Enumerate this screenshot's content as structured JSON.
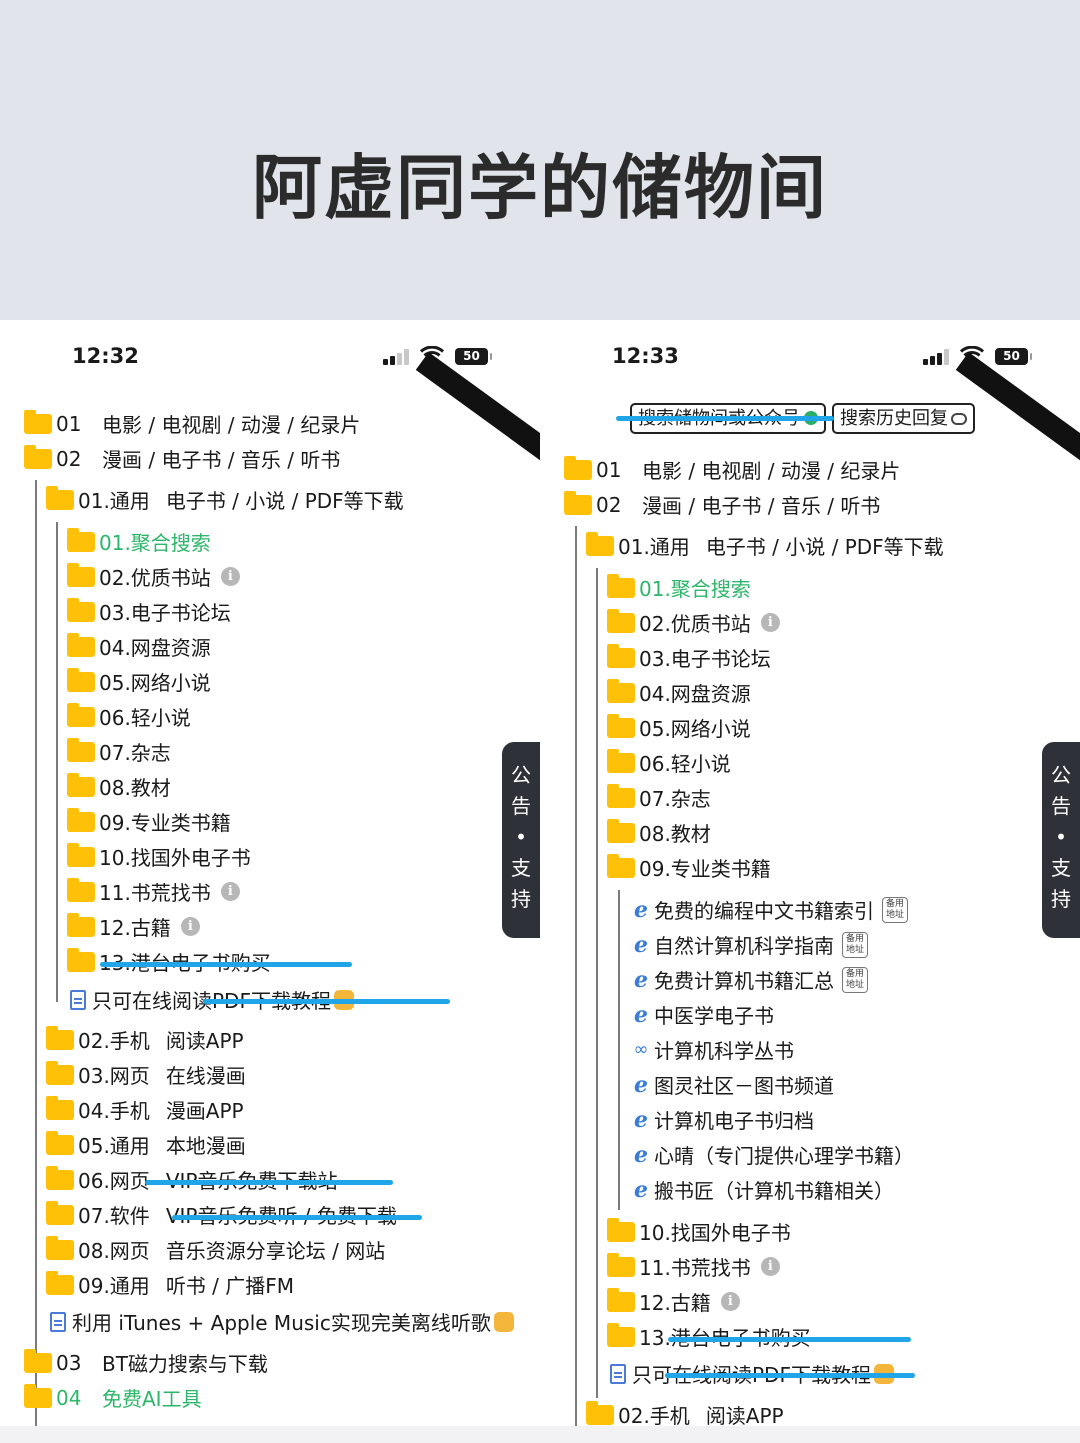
{
  "banner": {
    "title": "阿虚同学的储物间"
  },
  "left": {
    "time": "12:32",
    "battery": "50",
    "notice": [
      "公",
      "告",
      "•",
      "支",
      "持"
    ],
    "top_folders": [
      {
        "num": "01",
        "label": "电影 / 电视剧 / 动漫 / 纪录片"
      },
      {
        "num": "02",
        "label": "漫画 / 电子书 / 音乐 / 听书"
      }
    ],
    "sub_folder": {
      "num": "01.通用",
      "label": "电子书 / 小说 / PDF等下载"
    },
    "items": [
      {
        "label": "01.聚合搜索"
      },
      {
        "label": "02.优质书站"
      },
      {
        "label": "03.电子书论坛"
      },
      {
        "label": "04.网盘资源"
      },
      {
        "label": "05.网络小说"
      },
      {
        "label": "06.轻小说"
      },
      {
        "label": "07.杂志"
      },
      {
        "label": "08.教材"
      },
      {
        "label": "09.专业类书籍"
      },
      {
        "label": "10.找国外电子书"
      },
      {
        "label": "11.书荒找书"
      },
      {
        "label": "12.古籍"
      },
      {
        "label": "13.港台电子书购买"
      }
    ],
    "doc_item": "只可在线阅读PDF下载教程",
    "more_folders": [
      {
        "num": "02.手机",
        "label": "阅读APP"
      },
      {
        "num": "03.网页",
        "label": "在线漫画"
      },
      {
        "num": "04.手机",
        "label": "漫画APP"
      },
      {
        "num": "05.通用",
        "label": "本地漫画"
      },
      {
        "num": "06.网页",
        "label": "VIP音乐免费下载站"
      },
      {
        "num": "07.软件",
        "label": "VIP音乐免费听 / 免费下载"
      },
      {
        "num": "08.网页",
        "label": "音乐资源分享论坛 / 网站"
      },
      {
        "num": "09.通用",
        "label": "听书 / 广播FM"
      }
    ],
    "doc_item2": "利用 iTunes + Apple Music实现完美离线听歌",
    "bottom_folders": [
      {
        "num": "03",
        "label": "BT磁力搜索与下载"
      },
      {
        "num": "04",
        "label": "免费AI工具"
      }
    ]
  },
  "right": {
    "time": "12:33",
    "battery": "50",
    "notice": [
      "公",
      "告",
      "•",
      "支",
      "持"
    ],
    "search_chip": "搜索储物间或公众号",
    "history_chip": "搜索历史回复",
    "top_folders": [
      {
        "num": "01",
        "label": "电影 / 电视剧 / 动漫 / 纪录片"
      },
      {
        "num": "02",
        "label": "漫画 / 电子书 / 音乐 / 听书"
      }
    ],
    "sub_folder": {
      "num": "01.通用",
      "label": "电子书 / 小说 / PDF等下载"
    },
    "items": [
      {
        "label": "01.聚合搜索"
      },
      {
        "label": "02.优质书站"
      },
      {
        "label": "03.电子书论坛"
      },
      {
        "label": "04.网盘资源"
      },
      {
        "label": "05.网络小说"
      },
      {
        "label": "06.轻小说"
      },
      {
        "label": "07.杂志"
      },
      {
        "label": "08.教材"
      },
      {
        "label": "09.专业类书籍"
      }
    ],
    "links": [
      {
        "icon": "e",
        "label": "免费的编程中文书籍索引",
        "badge": "备用 地址"
      },
      {
        "icon": "e",
        "label": "自然计算机科学指南",
        "badge": "备用 地址"
      },
      {
        "icon": "e",
        "label": "免费计算机书籍汇总",
        "badge": "备用 地址"
      },
      {
        "icon": "e",
        "label": "中医学电子书"
      },
      {
        "icon": "link",
        "label": "计算机科学丛书"
      },
      {
        "icon": "e",
        "label": "图灵社区－图书频道"
      },
      {
        "icon": "e",
        "label": "计算机电子书归档"
      },
      {
        "icon": "e",
        "label": "心晴（专门提供心理学书籍）"
      },
      {
        "icon": "e",
        "label": "搬书匠（计算机书籍相关）"
      }
    ],
    "items_after": [
      {
        "label": "10.找国外电子书"
      },
      {
        "label": "11.书荒找书"
      },
      {
        "label": "12.古籍"
      },
      {
        "label": "13.港台电子书购买"
      }
    ],
    "doc_item": "只可在线阅读PDF下载教程",
    "last_folder": {
      "num": "02.手机",
      "label": "阅读APP"
    }
  },
  "colors": {
    "accent_green": "#2db669",
    "folder": "#ffc107",
    "strike_blue": "#1fa5e8"
  }
}
